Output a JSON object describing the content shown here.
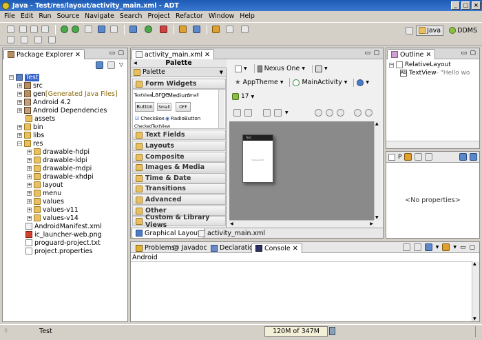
{
  "window": {
    "title": "Java - Test/res/layout/activity_main.xml - ADT"
  },
  "menu": [
    "File",
    "Edit",
    "Run",
    "Source",
    "Navigate",
    "Search",
    "Project",
    "Refactor",
    "Window",
    "Help"
  ],
  "perspectives": [
    {
      "label": "Java",
      "active": true
    },
    {
      "label": "DDMS",
      "active": false
    }
  ],
  "package_explorer": {
    "tab": "Package Explorer",
    "tree": [
      {
        "label": "Test",
        "depth": 0,
        "expand": "-",
        "icon": "project-icon"
      },
      {
        "label": "src",
        "depth": 1,
        "expand": "+",
        "icon": "source-folder-icon"
      },
      {
        "label": "gen",
        "suffix": " [Generated Java Files]",
        "depth": 1,
        "expand": "+",
        "icon": "source-folder-icon"
      },
      {
        "label": "Android 4.2",
        "depth": 1,
        "expand": "+",
        "icon": "library-icon"
      },
      {
        "label": "Android Dependencies",
        "depth": 1,
        "expand": "+",
        "icon": "library-icon"
      },
      {
        "label": "assets",
        "depth": 1,
        "expand": "",
        "icon": "folder-icon"
      },
      {
        "label": "bin",
        "depth": 1,
        "expand": "+",
        "icon": "folder-icon"
      },
      {
        "label": "libs",
        "depth": 1,
        "expand": "+",
        "icon": "folder-icon"
      },
      {
        "label": "res",
        "depth": 1,
        "expand": "-",
        "icon": "folder-icon"
      },
      {
        "label": "drawable-hdpi",
        "depth": 2,
        "expand": "+",
        "icon": "folder-icon"
      },
      {
        "label": "drawable-ldpi",
        "depth": 2,
        "expand": "+",
        "icon": "folder-icon"
      },
      {
        "label": "drawable-mdpi",
        "depth": 2,
        "expand": "+",
        "icon": "folder-icon"
      },
      {
        "label": "drawable-xhdpi",
        "depth": 2,
        "expand": "+",
        "icon": "folder-icon"
      },
      {
        "label": "layout",
        "depth": 2,
        "expand": "+",
        "icon": "folder-icon"
      },
      {
        "label": "menu",
        "depth": 2,
        "expand": "+",
        "icon": "folder-icon"
      },
      {
        "label": "values",
        "depth": 2,
        "expand": "+",
        "icon": "folder-icon"
      },
      {
        "label": "values-v11",
        "depth": 2,
        "expand": "+",
        "icon": "folder-icon"
      },
      {
        "label": "values-v14",
        "depth": 2,
        "expand": "+",
        "icon": "folder-icon"
      },
      {
        "label": "AndroidManifest.xml",
        "depth": 1,
        "expand": "",
        "icon": "xml-file-icon"
      },
      {
        "label": "ic_launcher-web.png",
        "depth": 1,
        "expand": "",
        "icon": "image-file-icon"
      },
      {
        "label": "proguard-project.txt",
        "depth": 1,
        "expand": "",
        "icon": "text-file-icon"
      },
      {
        "label": "project.properties",
        "depth": 1,
        "expand": "",
        "icon": "properties-file-icon"
      }
    ]
  },
  "editor": {
    "tab": "activity_main.xml",
    "palette_bar": "Palette",
    "palette_title": "Palette",
    "form_widgets": "Form Widgets",
    "widgets": {
      "textview": "TextView",
      "large": "Large",
      "medium": "Medium",
      "small": "Small",
      "button": "Button",
      "small_btn": "Small",
      "off": "OFF",
      "checkbox": "CheckBox",
      "radio": "RadioButton",
      "checked": "CheckedTextView"
    },
    "categories": [
      "Text Fields",
      "Layouts",
      "Composite",
      "Images & Media",
      "Time & Date",
      "Transitions",
      "Advanced",
      "Other",
      "Custom & Library Views"
    ],
    "device": "Nexus One",
    "theme": "AppTheme",
    "activity": "MainActivity",
    "api": "17",
    "device_preview": {
      "app_title": "Test",
      "text": "Hello world!"
    },
    "bottom_tabs": [
      "Graphical Layout",
      "activity_main.xml"
    ]
  },
  "outline": {
    "tab": "Outline",
    "root": "RelativeLayout",
    "child": "TextView",
    "child_text": " - \"Hello wo"
  },
  "properties": {
    "tab": "P",
    "empty": "<No properties>"
  },
  "console": {
    "tabs": [
      "Problems",
      "Javadoc",
      "Declaration",
      "Console"
    ],
    "active": "Console",
    "label": "Android"
  },
  "status": {
    "selected": "Test",
    "memory": "120M of 347M"
  }
}
